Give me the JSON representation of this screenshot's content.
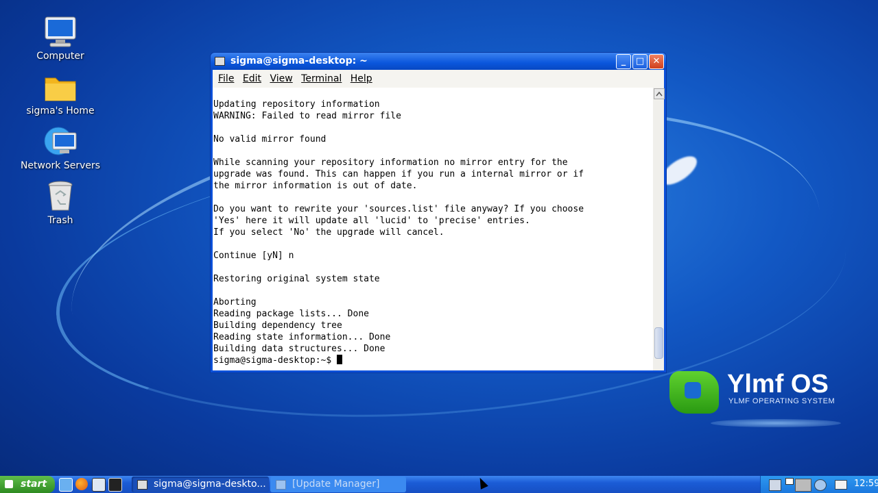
{
  "desktop": {
    "icons": [
      {
        "label": "Computer"
      },
      {
        "label": "sigma's Home"
      },
      {
        "label": "Network Servers"
      },
      {
        "label": "Trash"
      }
    ]
  },
  "logo": {
    "title": "Ylmf OS",
    "subtitle": "YLMF OPERATING SYSTEM"
  },
  "window": {
    "title": "sigma@sigma-desktop: ~",
    "buttons": {
      "minimize": "_",
      "maximize": "□",
      "close": "✕"
    },
    "menu": [
      "File",
      "Edit",
      "View",
      "Terminal",
      "Help"
    ],
    "terminal_text": "Updating repository information\nWARNING: Failed to read mirror file\n\nNo valid mirror found\n\nWhile scanning your repository information no mirror entry for the\nupgrade was found. This can happen if you run a internal mirror or if\nthe mirror information is out of date.\n\nDo you want to rewrite your 'sources.list' file anyway? If you choose\n'Yes' here it will update all 'lucid' to 'precise' entries.\nIf you select 'No' the upgrade will cancel.\n\nContinue [yN] n\n\nRestoring original system state\n\nAborting\nReading package lists... Done\nBuilding dependency tree\nReading state information... Done\nBuilding data structures... Done\n",
    "prompt": "sigma@sigma-desktop:~$ "
  },
  "taskbar": {
    "start_label": "start",
    "tasks": [
      {
        "label": "sigma@sigma-deskto..."
      },
      {
        "label": "[Update Manager]"
      }
    ],
    "clock": "12:59"
  },
  "colors": {
    "accent": "#1258c4",
    "start_green": "#2e8b21"
  }
}
